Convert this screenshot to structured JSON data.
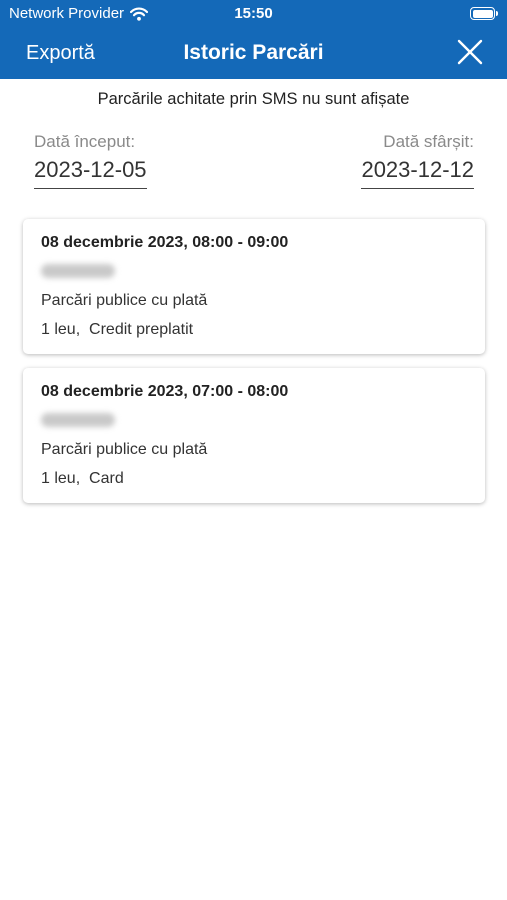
{
  "status_bar": {
    "carrier": "Network Provider",
    "time": "15:50",
    "battery_level": 1.0
  },
  "nav": {
    "export_label": "Exportă",
    "title": "Istoric Parcări",
    "close_icon": "close-icon"
  },
  "note": "Parcările achitate prin SMS nu sunt afișate",
  "dates": {
    "start_label": "Dată început:",
    "start_value": "2023-12-05",
    "end_label": "Dată sfârșit:",
    "end_value": "2023-12-12"
  },
  "parkings": [
    {
      "datetime": "08 decembrie 2023, 08:00 - 09:00",
      "zone": "Parcări publice cu plată",
      "payment": "1 leu,  Credit preplatit"
    },
    {
      "datetime": "08 decembrie 2023, 07:00 - 08:00",
      "zone": "Parcări publice cu plată",
      "payment": "1 leu,  Card"
    }
  ],
  "colors": {
    "header_bg": "#1469b8",
    "text_primary": "#222222",
    "label_gray": "#8a8a8a"
  }
}
